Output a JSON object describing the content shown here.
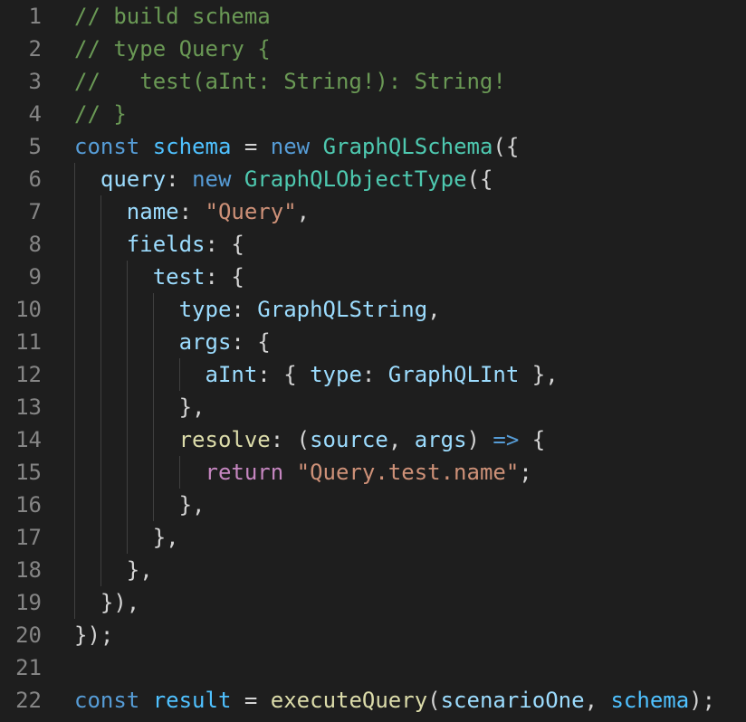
{
  "editor": {
    "language": "javascript",
    "theme_colors": {
      "background": "#1e1e1e",
      "line_number": "#858585",
      "comment": "#6a9955",
      "keyword": "#569cd6",
      "control_keyword": "#c586c0",
      "variable": "#4fc1ff",
      "property": "#9cdcfe",
      "type": "#4ec9b0",
      "function": "#dcdcaa",
      "string": "#ce9178",
      "punctuation": "#d4d4d4"
    },
    "lines": [
      {
        "number": "1",
        "tokens": [
          {
            "t": "// build schema",
            "k": "comment"
          }
        ]
      },
      {
        "number": "2",
        "tokens": [
          {
            "t": "// type Query {",
            "k": "comment"
          }
        ]
      },
      {
        "number": "3",
        "tokens": [
          {
            "t": "//   test(aInt: String!): String!",
            "k": "comment"
          }
        ]
      },
      {
        "number": "4",
        "tokens": [
          {
            "t": "// }",
            "k": "comment"
          }
        ]
      },
      {
        "number": "5",
        "tokens": [
          {
            "t": "const",
            "k": "keyword"
          },
          {
            "t": " ",
            "k": "punct"
          },
          {
            "t": "schema",
            "k": "var"
          },
          {
            "t": " = ",
            "k": "punct"
          },
          {
            "t": "new",
            "k": "keyword"
          },
          {
            "t": " ",
            "k": "punct"
          },
          {
            "t": "GraphQLSchema",
            "k": "type"
          },
          {
            "t": "({",
            "k": "punct"
          }
        ]
      },
      {
        "number": "6",
        "tokens": [
          {
            "t": "  ",
            "k": "punct"
          },
          {
            "t": "query",
            "k": "prop"
          },
          {
            "t": ": ",
            "k": "punct"
          },
          {
            "t": "new",
            "k": "keyword"
          },
          {
            "t": " ",
            "k": "punct"
          },
          {
            "t": "GraphQLObjectType",
            "k": "type"
          },
          {
            "t": "({",
            "k": "punct"
          }
        ]
      },
      {
        "number": "7",
        "tokens": [
          {
            "t": "    ",
            "k": "punct"
          },
          {
            "t": "name",
            "k": "prop"
          },
          {
            "t": ": ",
            "k": "punct"
          },
          {
            "t": "\"Query\"",
            "k": "string"
          },
          {
            "t": ",",
            "k": "punct"
          }
        ]
      },
      {
        "number": "8",
        "tokens": [
          {
            "t": "    ",
            "k": "punct"
          },
          {
            "t": "fields",
            "k": "prop"
          },
          {
            "t": ": {",
            "k": "punct"
          }
        ]
      },
      {
        "number": "9",
        "tokens": [
          {
            "t": "      ",
            "k": "punct"
          },
          {
            "t": "test",
            "k": "prop"
          },
          {
            "t": ": {",
            "k": "punct"
          }
        ]
      },
      {
        "number": "10",
        "tokens": [
          {
            "t": "        ",
            "k": "punct"
          },
          {
            "t": "type",
            "k": "prop"
          },
          {
            "t": ": ",
            "k": "punct"
          },
          {
            "t": "GraphQLString",
            "k": "prop"
          },
          {
            "t": ",",
            "k": "punct"
          }
        ]
      },
      {
        "number": "11",
        "tokens": [
          {
            "t": "        ",
            "k": "punct"
          },
          {
            "t": "args",
            "k": "prop"
          },
          {
            "t": ": {",
            "k": "punct"
          }
        ]
      },
      {
        "number": "12",
        "tokens": [
          {
            "t": "          ",
            "k": "punct"
          },
          {
            "t": "aInt",
            "k": "prop"
          },
          {
            "t": ": { ",
            "k": "punct"
          },
          {
            "t": "type",
            "k": "prop"
          },
          {
            "t": ": ",
            "k": "punct"
          },
          {
            "t": "GraphQLInt",
            "k": "prop"
          },
          {
            "t": " },",
            "k": "punct"
          }
        ]
      },
      {
        "number": "13",
        "tokens": [
          {
            "t": "        },",
            "k": "punct"
          }
        ]
      },
      {
        "number": "14",
        "tokens": [
          {
            "t": "        ",
            "k": "punct"
          },
          {
            "t": "resolve",
            "k": "func"
          },
          {
            "t": ": (",
            "k": "punct"
          },
          {
            "t": "source",
            "k": "prop"
          },
          {
            "t": ", ",
            "k": "punct"
          },
          {
            "t": "args",
            "k": "prop"
          },
          {
            "t": ") ",
            "k": "punct"
          },
          {
            "t": "=>",
            "k": "keyword"
          },
          {
            "t": " {",
            "k": "punct"
          }
        ]
      },
      {
        "number": "15",
        "tokens": [
          {
            "t": "          ",
            "k": "punct"
          },
          {
            "t": "return",
            "k": "control"
          },
          {
            "t": " ",
            "k": "punct"
          },
          {
            "t": "\"Query.test.name\"",
            "k": "string"
          },
          {
            "t": ";",
            "k": "punct"
          }
        ]
      },
      {
        "number": "16",
        "tokens": [
          {
            "t": "        },",
            "k": "punct"
          }
        ]
      },
      {
        "number": "17",
        "tokens": [
          {
            "t": "      },",
            "k": "punct"
          }
        ]
      },
      {
        "number": "18",
        "tokens": [
          {
            "t": "    },",
            "k": "punct"
          }
        ]
      },
      {
        "number": "19",
        "tokens": [
          {
            "t": "  }),",
            "k": "punct"
          }
        ]
      },
      {
        "number": "20",
        "tokens": [
          {
            "t": "});",
            "k": "punct"
          }
        ]
      },
      {
        "number": "21",
        "tokens": []
      },
      {
        "number": "22",
        "tokens": [
          {
            "t": "const",
            "k": "keyword"
          },
          {
            "t": " ",
            "k": "punct"
          },
          {
            "t": "result",
            "k": "var"
          },
          {
            "t": " = ",
            "k": "punct"
          },
          {
            "t": "executeQuery",
            "k": "func"
          },
          {
            "t": "(",
            "k": "punct"
          },
          {
            "t": "scenarioOne",
            "k": "prop"
          },
          {
            "t": ", ",
            "k": "punct"
          },
          {
            "t": "schema",
            "k": "var"
          },
          {
            "t": ");",
            "k": "punct"
          }
        ]
      }
    ]
  }
}
